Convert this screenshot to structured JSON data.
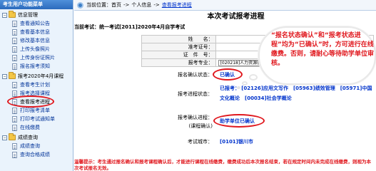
{
  "sidebar": {
    "header": "考生用户功能菜单",
    "groups": [
      {
        "label": "信息管理",
        "items": [
          "查看通知公告",
          "查看基本信息",
          "修改基本信息",
          "上传头像照片",
          "上传身份证照片",
          "报名报考须知"
        ]
      },
      {
        "label": "报考2020年4月课程",
        "items": [
          "查看考生计划",
          "报考选择课程",
          "查看报考进程",
          "打印报考清单",
          "打印考试通知单",
          "在线缴费"
        ]
      },
      {
        "label": "成绩查询",
        "items": [
          "成绩查询",
          "查询合格成绩"
        ]
      }
    ]
  },
  "breadcrumb": {
    "prefix": "当前位置：首页",
    "sep": "->",
    "level2": "个人信息",
    "current": "查看报考进程"
  },
  "main": {
    "title": "本次考试报考进程",
    "exam_line": "当前考试：统一考试[2011]2020年4月自学考试",
    "info": [
      {
        "label": "姓　　名：",
        "value": ""
      },
      {
        "label": "准考证号：",
        "value": ""
      },
      {
        "label": "证　件　号：",
        "value": ""
      },
      {
        "label": "报考专业：",
        "value": "[020218]人力资源管理(独立本科段)"
      }
    ],
    "status": {
      "confirm_label": "报名确认状态：",
      "confirm_value": "已确认",
      "progress_label": "报考进程状态：",
      "progress_prefix": "已报考：",
      "progress_value": "[02126]应用文写作　[05963]绩效管理　[05971]中国文化概论　[00034]社会学概论",
      "review_label_1": "报考确认进程：",
      "review_label_2": "(课程确认)",
      "review_value": "助学单位已确认",
      "city_label": "考试城市：",
      "city_value": "[0101]银川市"
    },
    "warning": "温馨提示：考生通过报名确认和报考课程确认后，才能进行课程在线缴费，缴费成功后本次报名结束，若在规定时间内未完成在线缴费，则视为本次考试报名无效。"
  },
  "callout": {
    "text": "“报名状态确认”和“报考状态进程”均为“已确认”时，方可进行在线缴费。否则，请耐心等待助学单位审核。"
  },
  "colors": {
    "accent_red": "#e0171d",
    "link_blue": "#0033cc",
    "sidebar_bg": "#eaf3fc"
  }
}
